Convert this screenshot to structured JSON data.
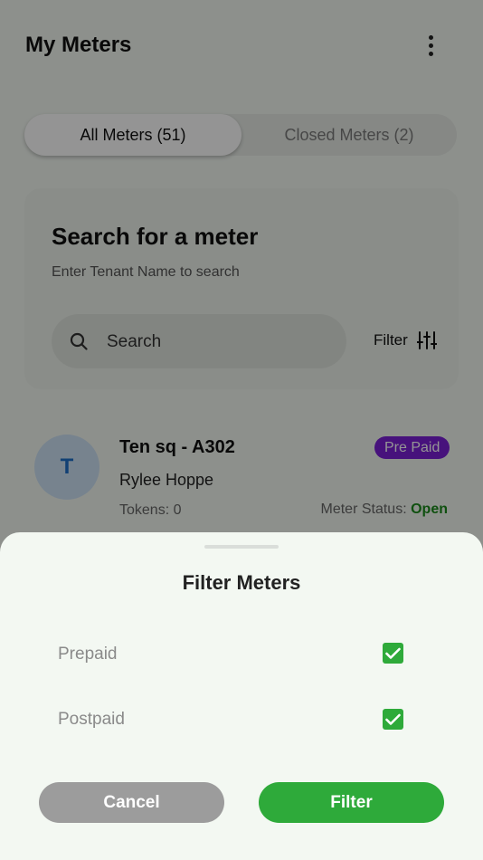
{
  "header": {
    "title": "My Meters"
  },
  "tabs": [
    {
      "label": "All Meters (51)",
      "active": true
    },
    {
      "label": "Closed Meters (2)",
      "active": false
    }
  ],
  "search": {
    "title": "Search for a meter",
    "subtitle": "Enter Tenant Name to search",
    "placeholder": "Search",
    "filter_label": "Filter"
  },
  "meters": [
    {
      "avatar_letter": "T",
      "name": "Ten sq - A302",
      "tenant": "Rylee Hoppe",
      "tokens": "Tokens: 0",
      "type_badge": "Pre Paid",
      "status_label": "Meter Status:",
      "status_value": "Open"
    }
  ],
  "filter_sheet": {
    "title": "Filter Meters",
    "options": [
      {
        "label": "Prepaid",
        "checked": true
      },
      {
        "label": "Postpaid",
        "checked": true
      }
    ],
    "cancel_label": "Cancel",
    "filter_label": "Filter"
  },
  "colors": {
    "accent_green": "#2eaa3a",
    "badge_purple": "#7a1fd6",
    "status_open": "#1a8a1a",
    "background": "#f3f8f2"
  },
  "icons": [
    "kebab-menu-icon",
    "search-icon",
    "filter-sliders-icon",
    "checkmark-icon"
  ]
}
